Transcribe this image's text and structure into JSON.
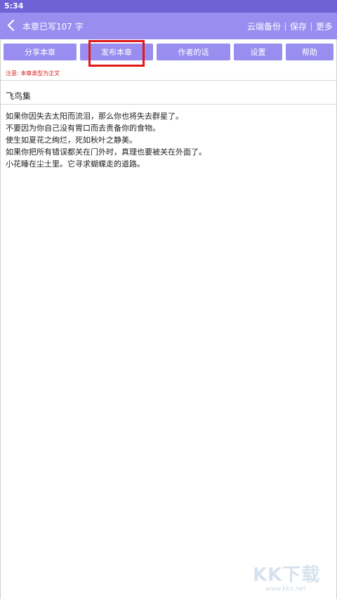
{
  "status": {
    "time": "5:34"
  },
  "appbar": {
    "title": "本章已写107 字",
    "actions": [
      "云端备份",
      "保存",
      "更多"
    ]
  },
  "toolbar": {
    "share": "分享本章",
    "publish": "发布本章",
    "author_note": "作者的话",
    "settings": "设置",
    "help": "帮助"
  },
  "notice": "注意: 本章类型为正文",
  "chapter": {
    "title": "飞鸟集",
    "lines": [
      "如果你因失去太阳而流泪，那么你也将失去群星了。",
      "不要因为你自己没有胃口而去责备你的食物。",
      "使生如夏花之绚烂，死如秋叶之静美。",
      "如果你把所有错误都关在门外时，真理也要被关在外面了。",
      "小花睡在尘土里。它寻求蝴蝶走的道路。"
    ]
  },
  "watermark": {
    "big": "KK下载",
    "small": "www.kkx.net"
  },
  "colors": {
    "accent": "#9a8df0",
    "status": "#6f62d6",
    "highlight": "#e01818",
    "notice": "#d81b1b"
  }
}
